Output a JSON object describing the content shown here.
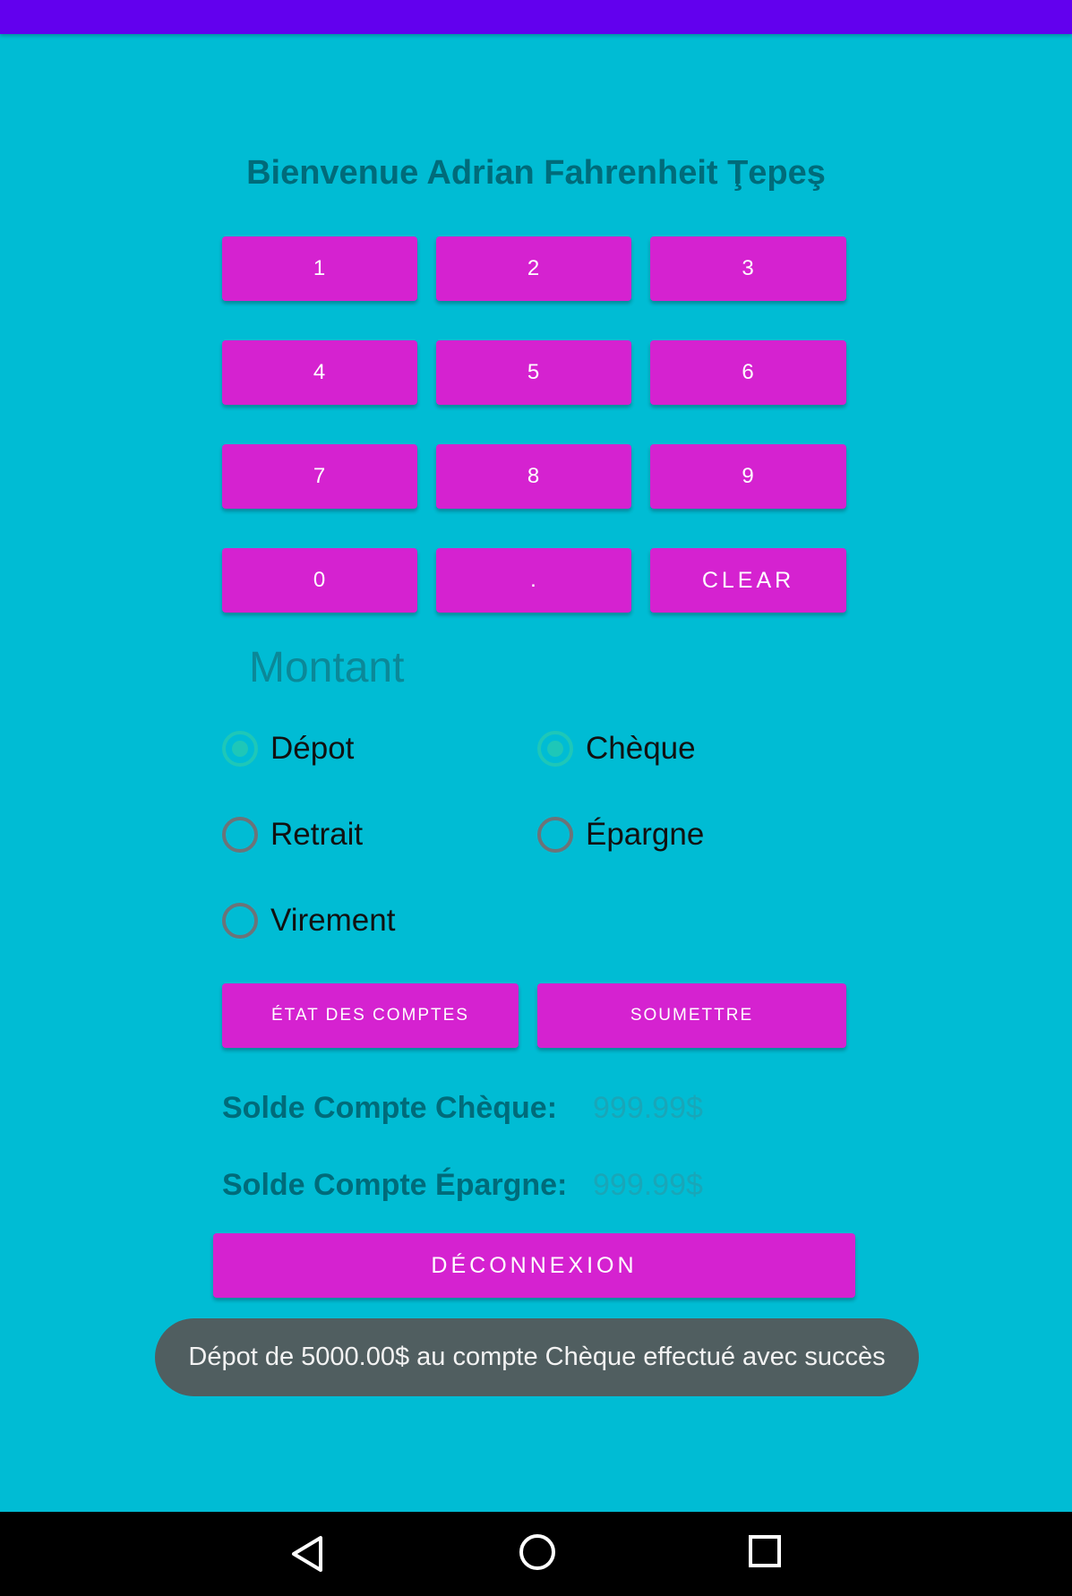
{
  "header": {
    "title": "Bienvenue Adrian Fahrenheit Ţepeş"
  },
  "keypad": {
    "keys": [
      "1",
      "2",
      "3",
      "4",
      "5",
      "6",
      "7",
      "8",
      "9",
      "0",
      ".",
      "CLEAR"
    ]
  },
  "amount": {
    "placeholder": "Montant"
  },
  "transaction_types": [
    {
      "label": "Dépot",
      "checked": true
    },
    {
      "label": "Retrait",
      "checked": false
    },
    {
      "label": "Virement",
      "checked": false
    }
  ],
  "accounts": [
    {
      "label": "Chèque",
      "checked": true
    },
    {
      "label": "Épargne",
      "checked": false
    }
  ],
  "actions": {
    "statement_label": "ÉTAT DES COMPTES",
    "submit_label": "SOUMETTRE",
    "logout_label": "DÉCONNEXION"
  },
  "balances": {
    "cheque_label": "Solde Compte Chèque:",
    "cheque_value": "999.99$",
    "savings_label": "Solde Compte Épargne:",
    "savings_value": "999.99$"
  },
  "toast": {
    "message": "Dépot de 5000.00$ au compte Chèque effectué avec succès"
  },
  "colors": {
    "background": "#00bcd4",
    "status_bar": "#6200ee",
    "button": "#d522d0",
    "radio_checked": "#1ec7b8",
    "title_text": "#006b7a",
    "toast_bg": "#505e60"
  },
  "nav": {
    "icons": [
      "back-icon",
      "home-icon",
      "recents-icon"
    ]
  }
}
